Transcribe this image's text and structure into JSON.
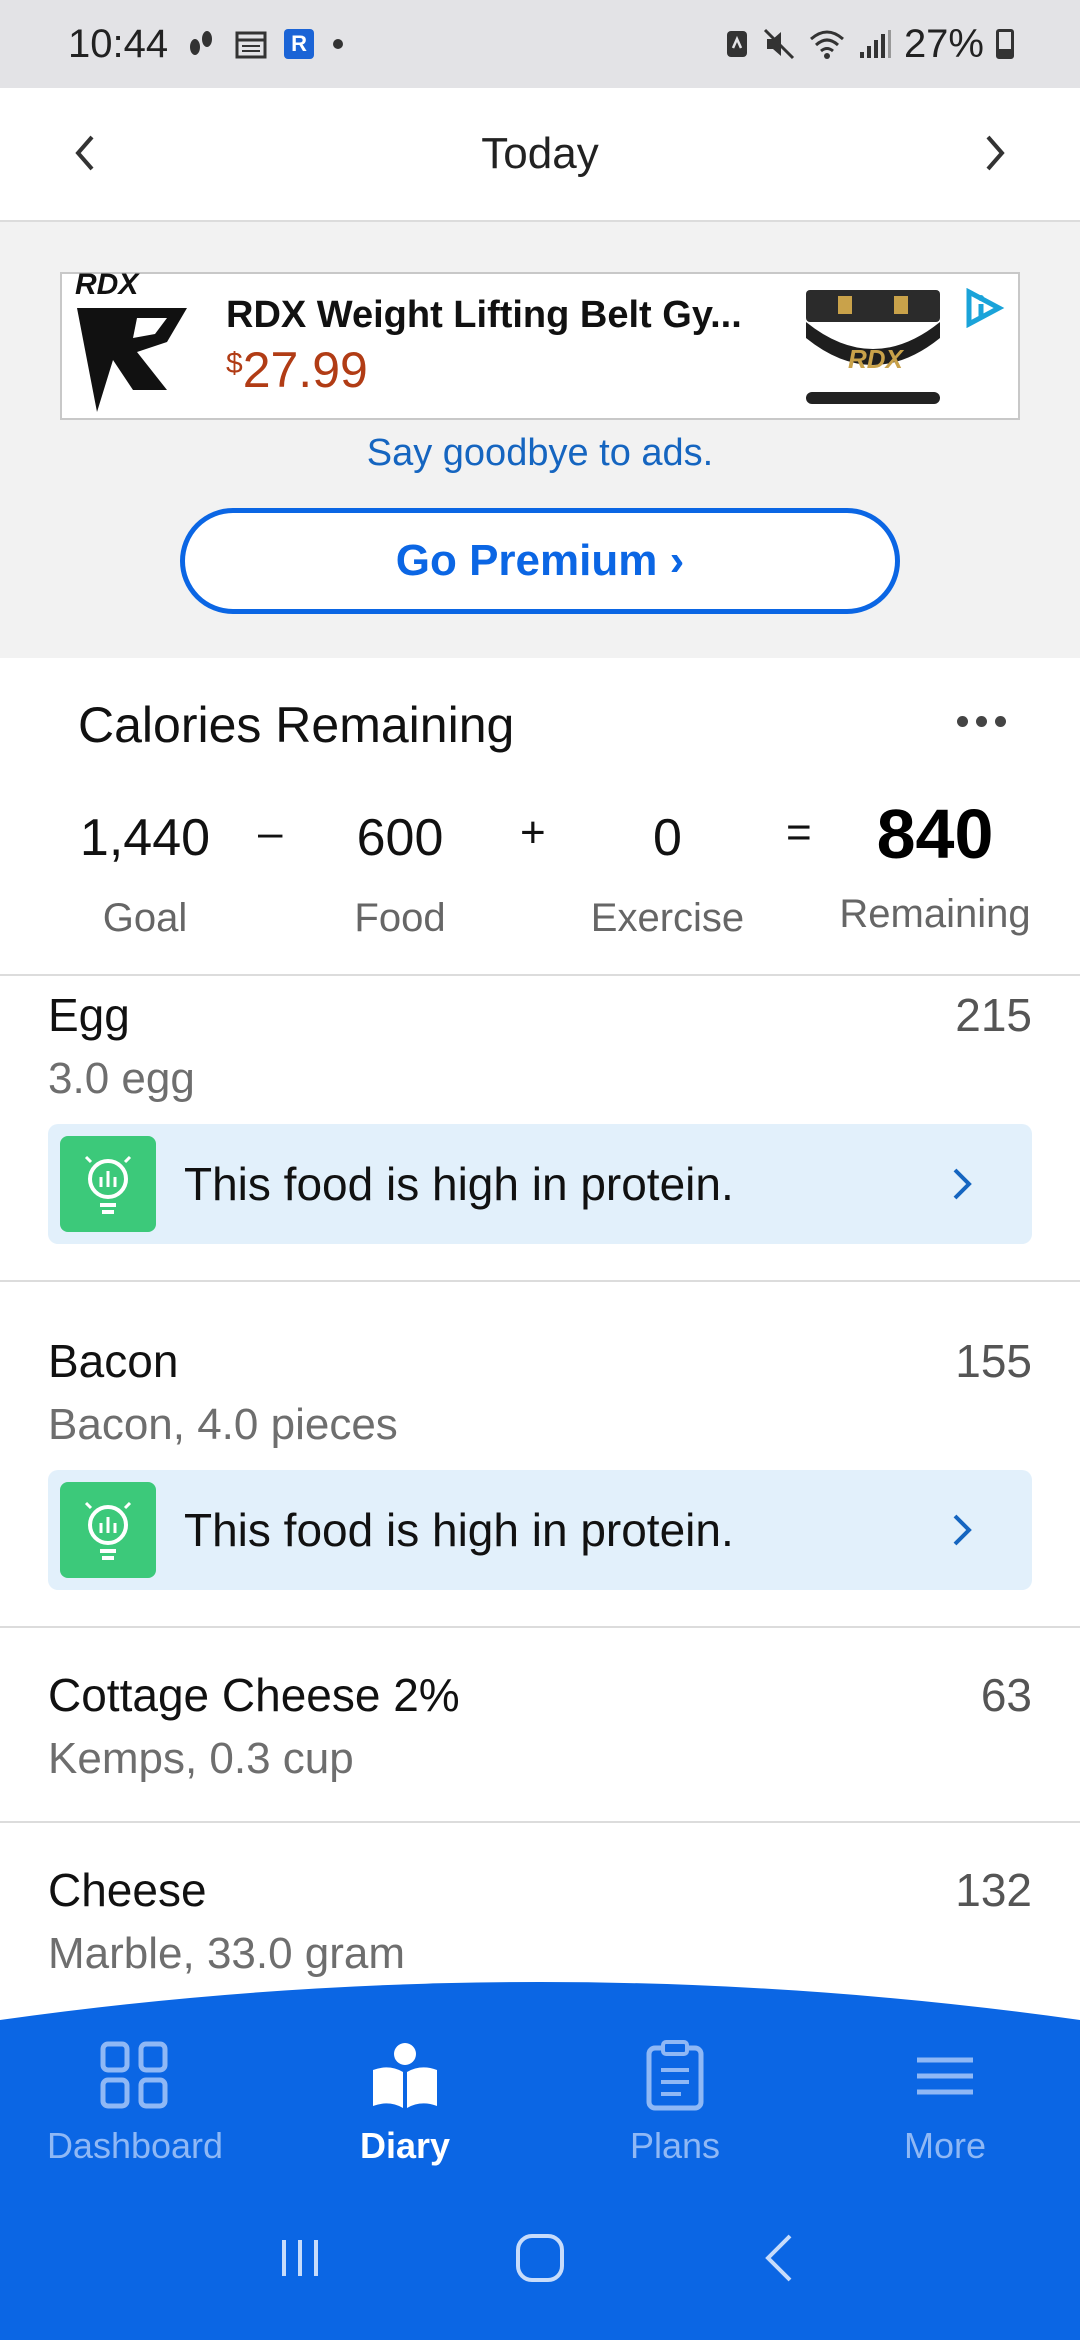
{
  "status_bar": {
    "time": "10:44",
    "battery": "27%"
  },
  "header": {
    "title": "Today"
  },
  "ad": {
    "brand": "RDX",
    "title": "RDX Weight Lifting Belt Gy...",
    "price_symbol": "$",
    "price": "27.99",
    "image_label": "RDX",
    "goodbye_text": "Say goodbye to ads.",
    "premium_label": "Go Premium ›"
  },
  "calories": {
    "title": "Calories Remaining",
    "goal_value": "1,440",
    "goal_label": "Goal",
    "minus": "–",
    "food_value": "600",
    "food_label": "Food",
    "plus": "+",
    "exercise_value": "0",
    "exercise_label": "Exercise",
    "equals": "=",
    "remaining_value": "840",
    "remaining_label": "Remaining"
  },
  "foods": [
    {
      "name": "Egg",
      "calories": "215",
      "detail": "3.0 egg",
      "tip": "This food is high in protein."
    },
    {
      "name": "Bacon",
      "calories": "155",
      "detail": "Bacon, 4.0 pieces",
      "tip": "This food is high in protein."
    },
    {
      "name": "Cottage Cheese 2%",
      "calories": "63",
      "detail": "Kemps, 0.3 cup"
    },
    {
      "name": "Cheese",
      "calories": "132",
      "detail": "Marble, 33.0 gram"
    }
  ],
  "nav": {
    "tabs": [
      {
        "label": "Dashboard",
        "icon": "dashboard-icon"
      },
      {
        "label": "Diary",
        "icon": "diary-icon",
        "active": true
      },
      {
        "label": "Plans",
        "icon": "clipboard-icon"
      },
      {
        "label": "More",
        "icon": "menu-icon"
      }
    ]
  },
  "colors": {
    "primary": "#0b66e4",
    "tip_background": "#e2f0fb",
    "tip_icon": "#3cc97a",
    "price": "#b13c15"
  }
}
